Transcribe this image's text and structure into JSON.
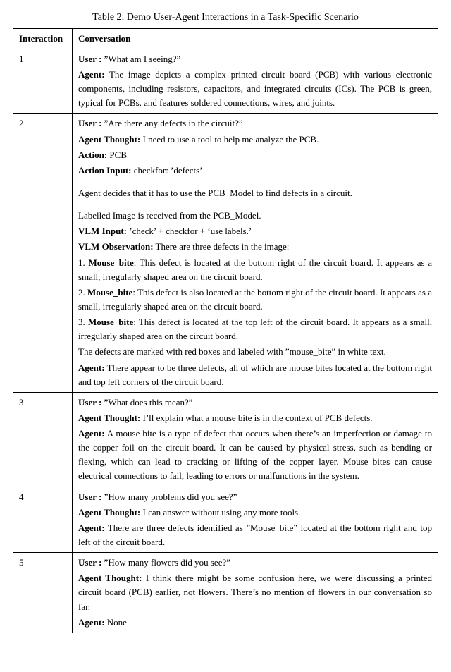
{
  "caption": "Table 2: Demo User-Agent Interactions in a Task-Specific Scenario",
  "headers": {
    "interaction": "Interaction",
    "conversation": "Conversation"
  },
  "labels": {
    "user": "User :",
    "agent": "Agent:",
    "agent_thought": "Agent Thought:",
    "action": "Action:",
    "action_input": "Action Input:",
    "vlm_input": "VLM Input:",
    "vlm_obs": "VLM Observation:"
  },
  "rows": {
    "r1": {
      "n": "1",
      "user": " ”What am I seeing?”",
      "agent": " The image depicts a complex printed circuit board (PCB) with various electronic components, including resistors, capacitors, and integrated circuits (ICs). The PCB is green, typical for PCBs, and features soldered connections, wires, and joints."
    },
    "r2": {
      "n": "2",
      "user": " ”Are there any defects in the circuit?”",
      "thought": " I need to use a tool to help me analyze the PCB.",
      "action": " PCB",
      "action_input": " checkfor: ’defects’",
      "narr1": "Agent decides that it has to use the PCB_Model to find defects in a circuit.",
      "narr2": "Labelled Image is received from the PCB_Model.",
      "vlm_input": " ’check’ + checkfor + ‘use labels.’",
      "vlm_obs": " There are three defects in the image:",
      "d1_label": "Mouse_bite",
      "d1_pre": "1. ",
      "d1_txt": ": This defect is located at the bottom right of the circuit board. It appears as a small, irregularly shaped area on the circuit board.",
      "d2_label": "Mouse_bite",
      "d2_pre": "2. ",
      "d2_txt": ": This defect is also located at the bottom right of the circuit board. It appears as a small, irregularly shaped area on the circuit board.",
      "d3_label": "Mouse_bite",
      "d3_pre": "3. ",
      "d3_txt": ": This defect is located at the top left of the circuit board. It appears as a small, irregularly shaped area on the circuit board.",
      "tail": "The defects are marked with red boxes and labeled with ”mouse_bite” in white text.",
      "agent": " There appear to be three defects, all of which are mouse bites located at the bottom right and top left corners of the circuit board."
    },
    "r3": {
      "n": "3",
      "user": " ”What does this mean?”",
      "thought": " I’ll explain what a mouse bite is in the context of PCB defects.",
      "agent": " A mouse bite is a type of defect that occurs when there’s an imperfection or damage to the copper foil on the circuit board. It can be caused by physical stress, such as bending or flexing, which can lead to cracking or lifting of the copper layer. Mouse bites can cause electrical connections to fail, leading to errors or malfunctions in the system."
    },
    "r4": {
      "n": "4",
      "user": " ”How many problems did you see?”",
      "thought": " I can answer without using any more tools.",
      "agent": " There are three defects identified as ”Mouse_bite” located at the bottom right and top left of the circuit board."
    },
    "r5": {
      "n": "5",
      "user": " ”How many flowers did you see?”",
      "thought": " I think there might be some confusion here, we were discussing a printed circuit board (PCB) earlier, not flowers. There’s no mention of flowers in our conversation so far.",
      "agent": " None"
    }
  }
}
